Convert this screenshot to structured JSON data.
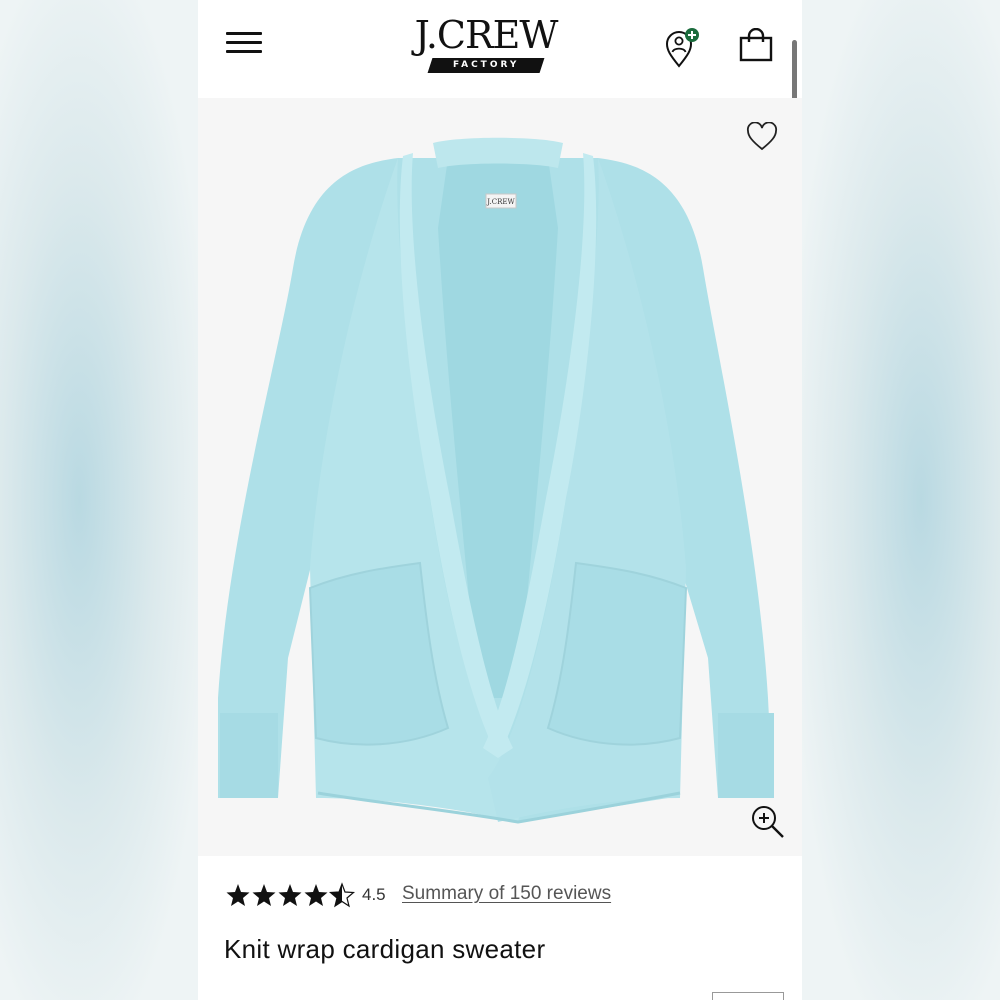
{
  "header": {
    "brand": "J.CREW",
    "brand_sub": "FACTORY",
    "menu_icon": "hamburger-menu-icon",
    "store_icon": "store-location-pin-icon",
    "bag_icon": "shopping-bag-icon"
  },
  "product": {
    "image_subject": "light blue knit wrap cardigan",
    "label_tag": "J.CREW",
    "rating": "4.5",
    "rating_fraction": 0.9,
    "stars_count": 5,
    "reviews_link": "Summary of 150 reviews",
    "title": "Knit wrap cardigan sweater",
    "favorite_icon": "heart-icon",
    "zoom_icon": "zoom-in-icon"
  },
  "colors": {
    "cardigan": "#aee0e8",
    "store_badge": "#1a6b3c",
    "text": "#111111"
  }
}
